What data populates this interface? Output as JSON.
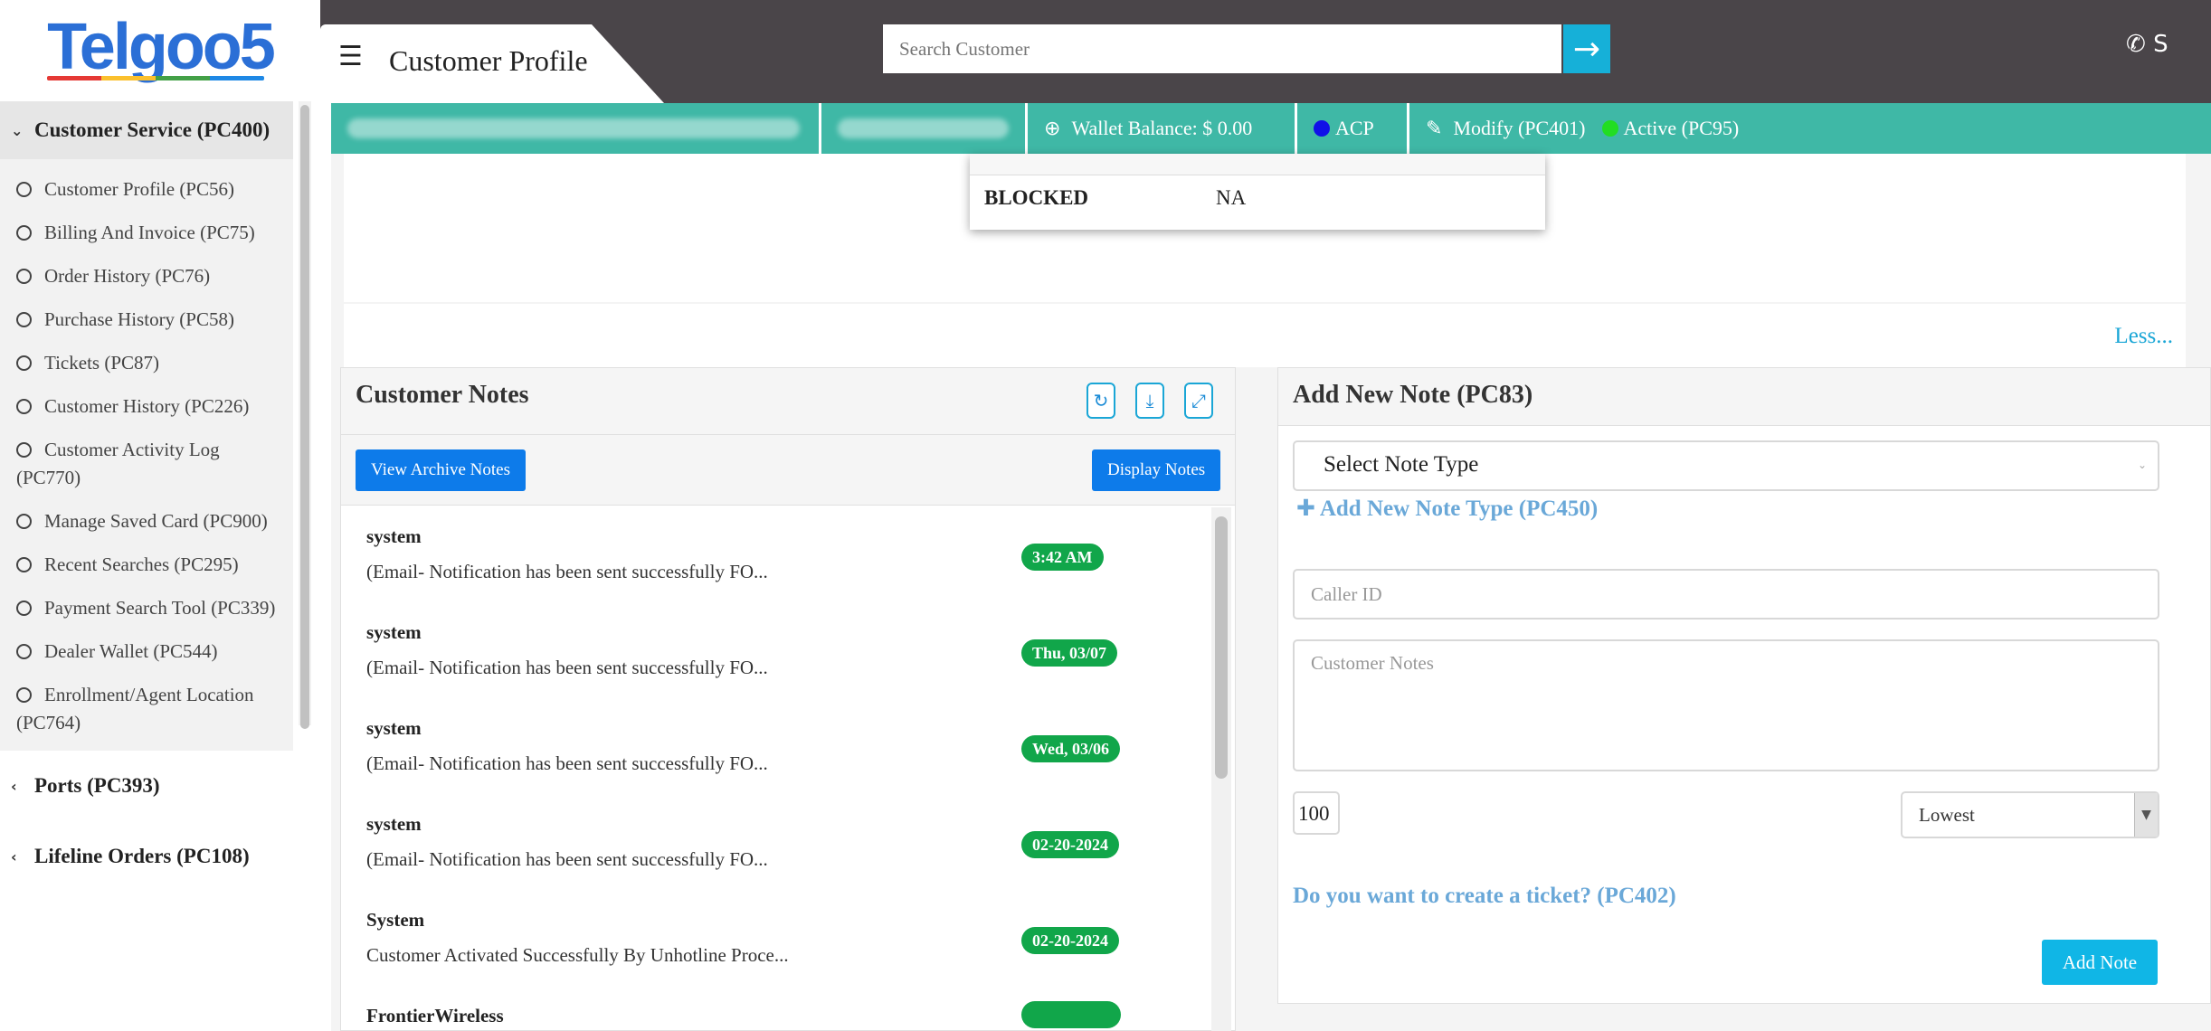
{
  "app": {
    "logo_text": "Telgoo5"
  },
  "header": {
    "page_title": "Customer Profile",
    "search_placeholder": "Search Customer",
    "phone_text": "S"
  },
  "sidebar": {
    "group_title": "Customer Service (PC400)",
    "items": [
      {
        "label": "Customer Profile (PC56)"
      },
      {
        "label": "Billing And Invoice (PC75)"
      },
      {
        "label": "Order History (PC76)"
      },
      {
        "label": "Purchase History (PC58)"
      },
      {
        "label": "Tickets (PC87)"
      },
      {
        "label": "Customer History (PC226)"
      },
      {
        "label": "Customer Activity Log (PC770)"
      },
      {
        "label": "Manage Saved Card (PC900)"
      },
      {
        "label": "Recent Searches (PC295)"
      },
      {
        "label": "Payment Search Tool (PC339)"
      },
      {
        "label": "Dealer Wallet (PC544)"
      },
      {
        "label": "Enrollment/Agent Location (PC764)"
      }
    ],
    "collapsed_groups": [
      {
        "label": "Ports (PC393)"
      },
      {
        "label": "Lifeline Orders (PC108)"
      }
    ]
  },
  "strip": {
    "wallet_balance": "Wallet Balance: $ 0.00",
    "acp": "ACP",
    "modify": "Modify (PC401)",
    "status": "Active (PC95)",
    "colors": {
      "background": "#3fb8a6",
      "acp_dot": "#1010e8",
      "active_dot": "#22dd22"
    }
  },
  "info": {
    "blocked_label": "BLOCKED",
    "blocked_value": "NA",
    "less_link": "Less..."
  },
  "notes_panel": {
    "title": "Customer Notes",
    "view_archive": "View Archive Notes",
    "display_notes": "Display Notes",
    "notes": [
      {
        "author": "system",
        "text": "(Email- Notification has been sent successfully FO...",
        "time": "3:42 AM"
      },
      {
        "author": "system",
        "text": "(Email- Notification has been sent successfully FO...",
        "time": "Thu, 03/07"
      },
      {
        "author": "system",
        "text": "(Email- Notification has been sent successfully FO...",
        "time": "Wed, 03/06"
      },
      {
        "author": "system",
        "text": "(Email- Notification has been sent successfully FO...",
        "time": "02-20-2024"
      },
      {
        "author": "System",
        "text": "Customer Activated Successfully By Unhotline Proce...",
        "time": "02-20-2024"
      },
      {
        "author": "FrontierWireless",
        "text": "",
        "time": ""
      }
    ]
  },
  "add_note": {
    "title": "Add New Note (PC83)",
    "select_note_type": "Select Note Type",
    "add_new_type": "Add New Note Type (PC450)",
    "caller_id_placeholder": "Caller ID",
    "customer_notes_placeholder": "Customer Notes",
    "char_counter": "100",
    "priority": "Lowest",
    "ticket_question": "Do you want to create a ticket? (PC402)",
    "submit": "Add Note"
  }
}
